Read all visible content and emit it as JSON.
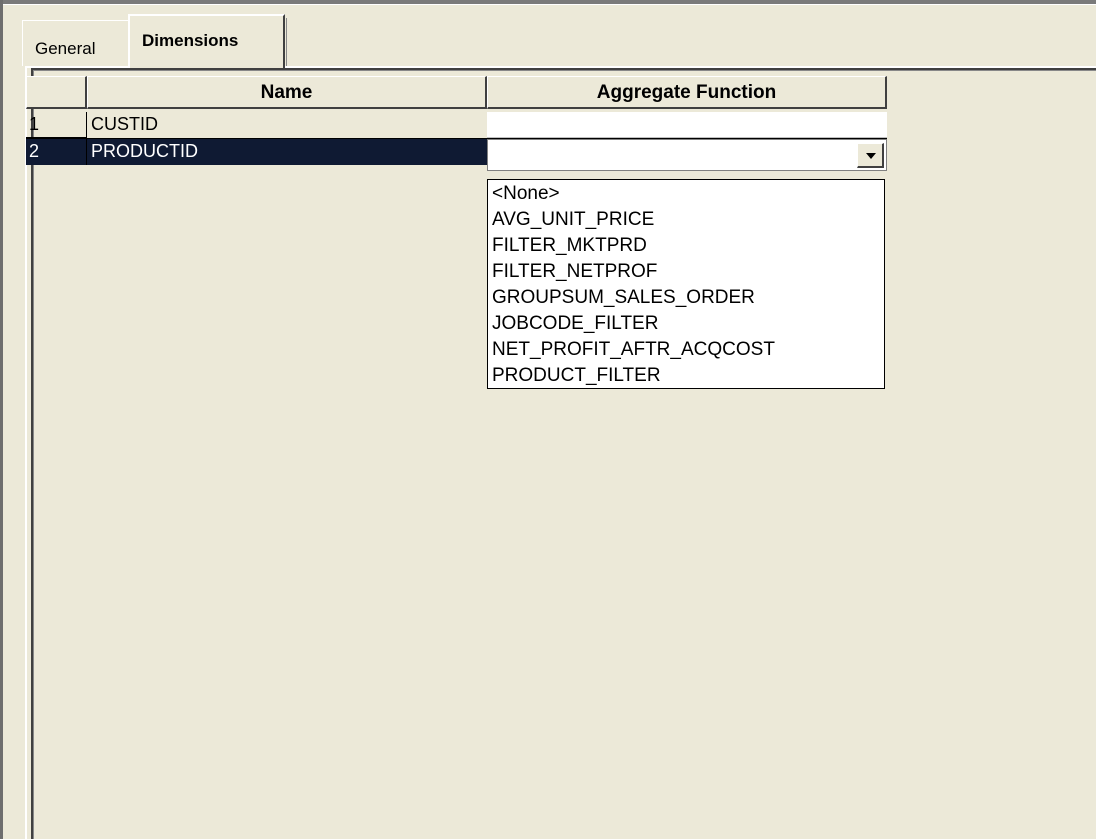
{
  "tabs": [
    {
      "label": "General",
      "active": false
    },
    {
      "label": "Dimensions",
      "active": true
    }
  ],
  "grid": {
    "columns": [
      "",
      "Name",
      "Aggregate Function"
    ],
    "rows": [
      {
        "num": "1",
        "name": "CUSTID",
        "aggregate": ""
      },
      {
        "num": "2",
        "name": "PRODUCTID",
        "aggregate": ""
      }
    ],
    "selected_row": "2"
  },
  "combobox": {
    "value": "",
    "options": [
      "<None>",
      "AVG_UNIT_PRICE",
      "FILTER_MKTPRD",
      "FILTER_NETPROF",
      "GROUPSUM_SALES_ORDER",
      "JOBCODE_FILTER",
      "NET_PROFIT_AFTR_ACQCOST",
      "PRODUCT_FILTER"
    ]
  },
  "colors": {
    "background": "#ece9d8",
    "selection": "#0f1a33",
    "selection_text": "#ffffff"
  },
  "icons": {
    "combo_button": "chevron-down-icon"
  }
}
